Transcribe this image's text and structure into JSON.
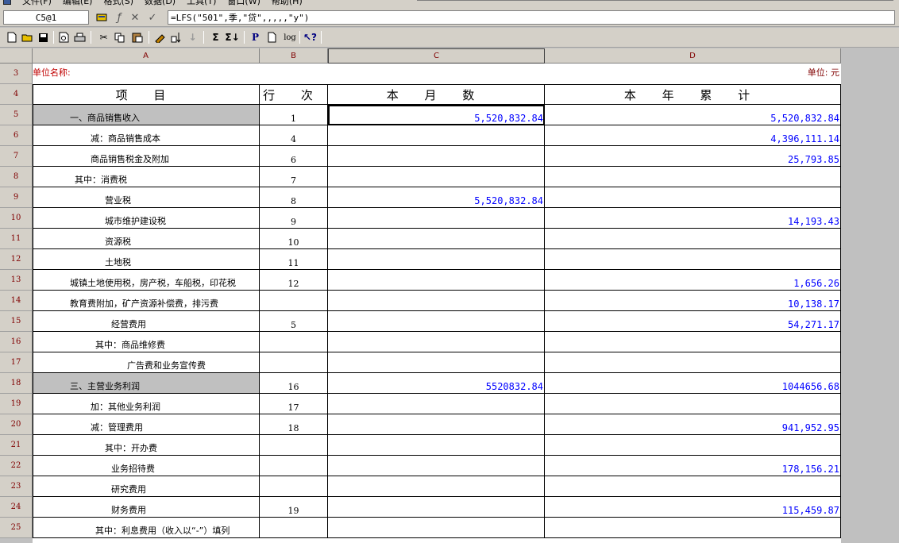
{
  "menu": [
    "文件(F)",
    "编辑(E)",
    "格式(S)",
    "数据(D)",
    "工具(T)",
    "窗口(W)",
    "帮助(H)"
  ],
  "formula_bar": {
    "cell_ref": "C5@1",
    "formula": "=LFS(\"501\",季,\"贷\",,,,,\"y\")"
  },
  "toolbar": {
    "icons": [
      "new-icon",
      "open-icon",
      "save-icon",
      "print-preview-icon",
      "print-icon",
      "cut-icon",
      "copy-icon",
      "paste-icon",
      "format-painter-icon",
      "sort-icon",
      "sort-desc-icon",
      "sum-icon",
      "sum-row-icon",
      "p-icon",
      "page-icon",
      "log-icon",
      "help-icon"
    ],
    "labels": {
      "sum": "Σ",
      "p": "P",
      "log": "log",
      "help": "?"
    }
  },
  "columns": [
    "A",
    "B",
    "C",
    "D"
  ],
  "rows": [
    3,
    4,
    5,
    6,
    7,
    8,
    9,
    10,
    11,
    12,
    13,
    14,
    15,
    16,
    17,
    18,
    19,
    20,
    21,
    22,
    23,
    24,
    25
  ],
  "sheet": {
    "unit_name_label": "单位名称:",
    "unit_label": "单位: 元",
    "header": {
      "item": "项 目",
      "line": "行 次",
      "month": "本 月 数",
      "year": "本 年 累 计"
    },
    "data_rows": [
      {
        "item": "一、商品销售收入",
        "line": "1",
        "month": "5,520,832.84",
        "year": "5,520,832.84",
        "grey": true
      },
      {
        "item": "减：商品销售成本",
        "line": "4",
        "month": "",
        "year": "4,396,111.14"
      },
      {
        "item": "商品销售税金及附加",
        "line": "6",
        "month": "",
        "year": "25,793.85"
      },
      {
        "item": "其中：消费税",
        "line": "7",
        "month": "",
        "year": ""
      },
      {
        "item": "营业税",
        "line": "8",
        "month": "5,520,832.84",
        "year": ""
      },
      {
        "item": "城市维护建设税",
        "line": "9",
        "month": "",
        "year": "14,193.43"
      },
      {
        "item": "资源税",
        "line": "10",
        "month": "",
        "year": ""
      },
      {
        "item": "土地税",
        "line": "11",
        "month": "",
        "year": ""
      },
      {
        "item": "城镇土地使用税，房产税，车船税，印花税",
        "line": "12",
        "month": "",
        "year": "1,656.26"
      },
      {
        "item": "教育费附加，矿产资源补偿费，排污费",
        "line": "",
        "month": "",
        "year": "10,138.17"
      },
      {
        "item": "经营费用",
        "line": "5",
        "month": "",
        "year": "54,271.17"
      },
      {
        "item": "其中：商品维修费",
        "line": "",
        "month": "",
        "year": ""
      },
      {
        "item": "广告费和业务宣传费",
        "line": "",
        "month": "",
        "year": ""
      },
      {
        "item": "三、主营业务利润",
        "line": "16",
        "month": "5520832.84",
        "year": "1044656.68",
        "grey": true
      },
      {
        "item": "加：其他业务利润",
        "line": "17",
        "month": "",
        "year": ""
      },
      {
        "item": "减：管理费用",
        "line": "18",
        "month": "",
        "year": "941,952.95"
      },
      {
        "item": "其中：开办费",
        "line": "",
        "month": "",
        "year": ""
      },
      {
        "item": "业务招待费",
        "line": "",
        "month": "",
        "year": "178,156.21"
      },
      {
        "item": "研究费用",
        "line": "",
        "month": "",
        "year": ""
      },
      {
        "item": "财务费用",
        "line": "19",
        "month": "",
        "year": "115,459.87"
      },
      {
        "item": "其中：利息费用（收入以“-”）填列",
        "line": "",
        "month": "",
        "year": ""
      }
    ]
  }
}
